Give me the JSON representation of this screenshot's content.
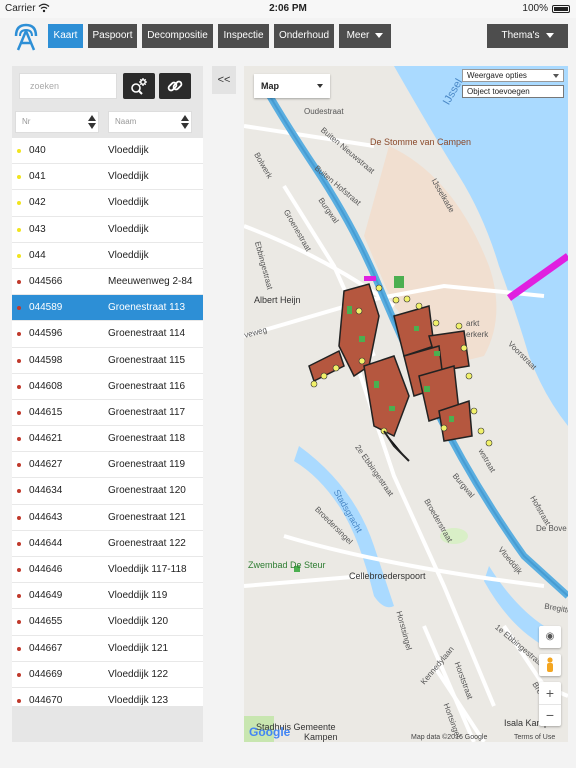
{
  "status": {
    "carrier": "Carrier",
    "time": "2:06 PM",
    "battery": "100%"
  },
  "nav": {
    "tabs": [
      {
        "label": "Kaart",
        "active": true
      },
      {
        "label": "Paspoort"
      },
      {
        "label": "Decompositie"
      },
      {
        "label": "Inspectie"
      },
      {
        "label": "Onderhoud"
      },
      {
        "label": "Meer"
      }
    ],
    "themes_label": "Thema's"
  },
  "search": {
    "placeholder": "zoeken"
  },
  "columns": {
    "nr": "Nr",
    "naam": "Naam"
  },
  "list": [
    {
      "nr": "040",
      "naam": "Vloeddijk",
      "status": "#f1e41f"
    },
    {
      "nr": "041",
      "naam": "Vloeddijk",
      "status": "#f1e41f"
    },
    {
      "nr": "042",
      "naam": "Vloeddijk",
      "status": "#f1e41f"
    },
    {
      "nr": "043",
      "naam": "Vloeddijk",
      "status": "#f1e41f"
    },
    {
      "nr": "044",
      "naam": "Vloeddijk",
      "status": "#f1e41f"
    },
    {
      "nr": "044566",
      "naam": "Meeuwenweg 2-84",
      "status": "#c0392b"
    },
    {
      "nr": "044589",
      "naam": "Groenestraat 113",
      "status": "#c0392b",
      "selected": true
    },
    {
      "nr": "044596",
      "naam": "Groenestraat 114",
      "status": "#c0392b"
    },
    {
      "nr": "044598",
      "naam": "Groenestraat 115",
      "status": "#c0392b"
    },
    {
      "nr": "044608",
      "naam": "Groenestraat 116",
      "status": "#c0392b"
    },
    {
      "nr": "044615",
      "naam": "Groenestraat 117",
      "status": "#c0392b"
    },
    {
      "nr": "044621",
      "naam": "Groenestraat 118",
      "status": "#c0392b"
    },
    {
      "nr": "044627",
      "naam": "Groenestraat 119",
      "status": "#c0392b"
    },
    {
      "nr": "044634",
      "naam": "Groenestraat 120",
      "status": "#c0392b"
    },
    {
      "nr": "044643",
      "naam": "Groenestraat 121",
      "status": "#c0392b"
    },
    {
      "nr": "044644",
      "naam": "Groenestraat 122",
      "status": "#c0392b"
    },
    {
      "nr": "044646",
      "naam": "Vloeddijk 117-118",
      "status": "#c0392b"
    },
    {
      "nr": "044649",
      "naam": "Vloeddijk 119",
      "status": "#c0392b"
    },
    {
      "nr": "044655",
      "naam": "Vloeddijk 120",
      "status": "#c0392b"
    },
    {
      "nr": "044667",
      "naam": "Vloeddijk 121",
      "status": "#c0392b"
    },
    {
      "nr": "044669",
      "naam": "Vloeddijk 122",
      "status": "#c0392b"
    },
    {
      "nr": "044670",
      "naam": "Vloeddijk 123",
      "status": "#c0392b"
    }
  ],
  "collapse_label": "<<",
  "map": {
    "type_label": "Map",
    "options_label": "Weergave opties",
    "add_object_label": "Object toevoegen",
    "zoom_in": "+",
    "zoom_out": "−",
    "google": "Google",
    "attribution": "Map data ©2016 Google",
    "terms": "Terms of Use",
    "labels": [
      {
        "text": "IJssel"
      },
      {
        "text": "Oudestraat"
      },
      {
        "text": "De Stomme van Campen"
      },
      {
        "text": "Buiten Nieuwstraat"
      },
      {
        "text": "Buiten Hofstraat"
      },
      {
        "text": "IJsselkade"
      },
      {
        "text": "Bolwerk"
      },
      {
        "text": "Burgwal"
      },
      {
        "text": "Groenestraat"
      },
      {
        "text": "Ebbingestraat"
      },
      {
        "text": "Albert Heijn"
      },
      {
        "text": "arkt"
      },
      {
        "text": "erkerk"
      },
      {
        "text": "veweg"
      },
      {
        "text": "Voorstraat"
      },
      {
        "text": "Stadsgracht"
      },
      {
        "text": "2e Ebbingestraat"
      },
      {
        "text": "Broederstraat"
      },
      {
        "text": "Broedersingel"
      },
      {
        "text": "Burgwal"
      },
      {
        "text": "wstraat"
      },
      {
        "text": "Hofstraat"
      },
      {
        "text": "Zwembad De Steur"
      },
      {
        "text": "Cellebroederspoort"
      },
      {
        "text": "Vloeddijk"
      },
      {
        "text": "De Bove"
      },
      {
        "text": "Horstsingel"
      },
      {
        "text": "Horststraat"
      },
      {
        "text": "1e Ebbingestraat"
      },
      {
        "text": "Kennedylaan"
      },
      {
        "text": "Breeestraat"
      },
      {
        "text": "Stadhuis Gemeente"
      },
      {
        "text": "Kampen"
      },
      {
        "text": "Isala Kampen"
      },
      {
        "text": "Bregittenstraat"
      },
      {
        "text": "Hortsingel"
      }
    ]
  }
}
